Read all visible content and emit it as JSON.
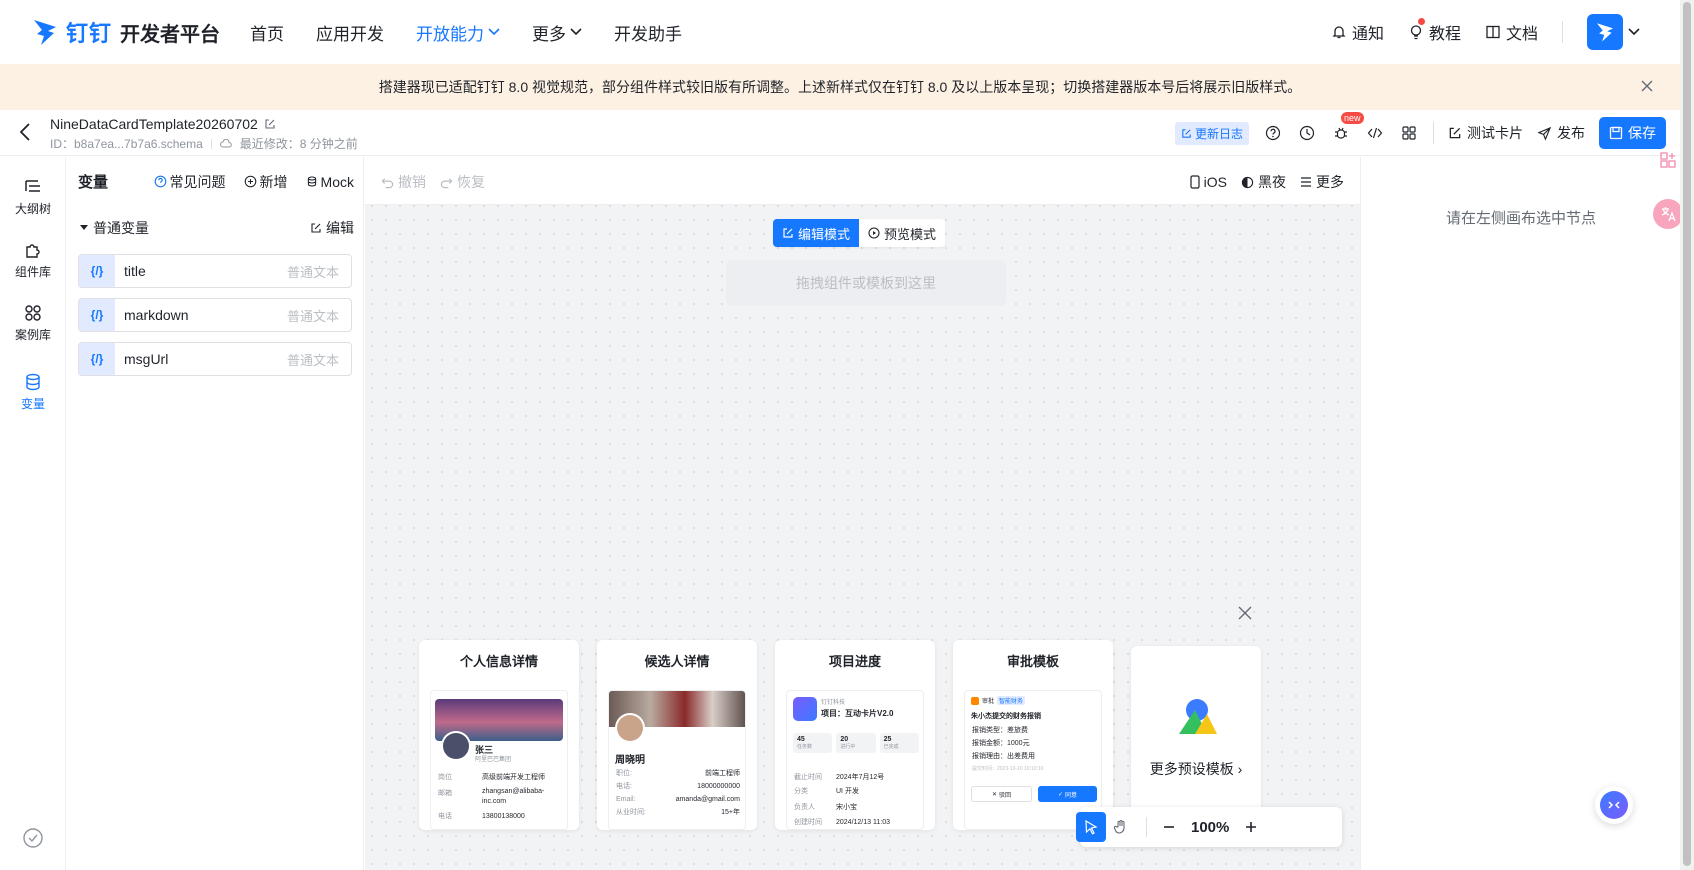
{
  "nav": {
    "brand": "钉钉",
    "brand_rest": "开发者平台",
    "items": [
      {
        "label": "首页"
      },
      {
        "label": "应用开发"
      },
      {
        "label": "开放能力"
      },
      {
        "label": "更多"
      },
      {
        "label": "开发助手"
      }
    ],
    "right": {
      "notify": "通知",
      "tutorial": "教程",
      "docs": "文档"
    }
  },
  "notice": {
    "text": "搭建器现已适配钉钉 8.0 视觉规范，部分组件样式较旧版有所调整。上述新样式仅在钉钉 8.0 及以上版本呈现；切换搭建器版本号后将展示旧版样式。"
  },
  "toolbar": {
    "template_name": "NineDataCardTemplate20260702",
    "id_text": "ID：b8a7ea...7b7a6.schema",
    "modified_text": "最近修改：8 分钟之前",
    "changelog": "更新日志",
    "new_badge": "new",
    "test_card": "测试卡片",
    "publish": "发布",
    "save": "保存"
  },
  "rail": [
    {
      "label": "大纲树"
    },
    {
      "label": "组件库"
    },
    {
      "label": "案例库"
    },
    {
      "label": "变量"
    }
  ],
  "variables": {
    "title": "变量",
    "faq": "常见问题",
    "add": "新增",
    "mock": "Mock",
    "group": "普通变量",
    "edit": "编辑",
    "badge": "{/}",
    "items": [
      {
        "name": "title",
        "type": "普通文本"
      },
      {
        "name": "markdown",
        "type": "普通文本"
      },
      {
        "name": "msgUrl",
        "type": "普通文本"
      }
    ]
  },
  "canvas": {
    "undo": "撤销",
    "redo": "恢复",
    "ios": "iOS",
    "dark": "黑夜",
    "more": "更多",
    "edit_mode": "编辑模式",
    "preview_mode": "预览模式",
    "dropzone": "拖拽组件或模板到这里",
    "zoom": "100%"
  },
  "templates": [
    {
      "title": "个人信息详情"
    },
    {
      "title": "候选人详情"
    },
    {
      "title": "项目进度"
    },
    {
      "title": "审批模板"
    }
  ],
  "more_templates": "更多预设模板",
  "tpl1": {
    "name": "张三",
    "company": "阿里巴巴集团",
    "rows": [
      {
        "k": "岗位",
        "v": "高级前端开发工程师"
      },
      {
        "k": "邮箱",
        "v": "zhangsan@alibaba-inc.com"
      },
      {
        "k": "电话",
        "v": "13800138000"
      }
    ]
  },
  "tpl2": {
    "name": "周晓明",
    "rows": [
      {
        "k": "职位:",
        "v": "前端工程师"
      },
      {
        "k": "电话:",
        "v": "18000000000"
      },
      {
        "k": "Email:",
        "v": "amanda@gmail.com"
      },
      {
        "k": "从业时间:",
        "v": "15+年"
      }
    ]
  },
  "tpl3": {
    "org": "钉钉科技",
    "project": "项目：互动卡片V2.0",
    "stats": [
      {
        "n": "45",
        "l": "任务数"
      },
      {
        "n": "20",
        "l": "进行中"
      },
      {
        "n": "25",
        "l": "已完成"
      }
    ],
    "rows": [
      {
        "k": "截止时间",
        "v": "2024年7月12号"
      },
      {
        "k": "分类",
        "v": "UI 开发"
      },
      {
        "k": "负责人",
        "v": "宋小宝"
      },
      {
        "k": "创建时间",
        "v": "2024/12/13 11:03"
      }
    ]
  },
  "tpl4": {
    "tag1": "审批",
    "tag2": "智能财务",
    "title": "朱小杰提交的财务报销",
    "rows": [
      {
        "k": "报销类型：",
        "v": "差旅费"
      },
      {
        "k": "报销金额：",
        "v": "1000元"
      },
      {
        "k": "报销理由：",
        "v": "出差费用"
      }
    ],
    "time": "提交时间：2023-10-10 10:10:10",
    "reject": "驳回",
    "approve": "同意"
  },
  "right_panel": {
    "empty": "请在左侧画布选中节点"
  },
  "colors": {
    "accent": "#1677ff",
    "notice_bg": "#fdf1e4",
    "danger": "#f54a45"
  }
}
